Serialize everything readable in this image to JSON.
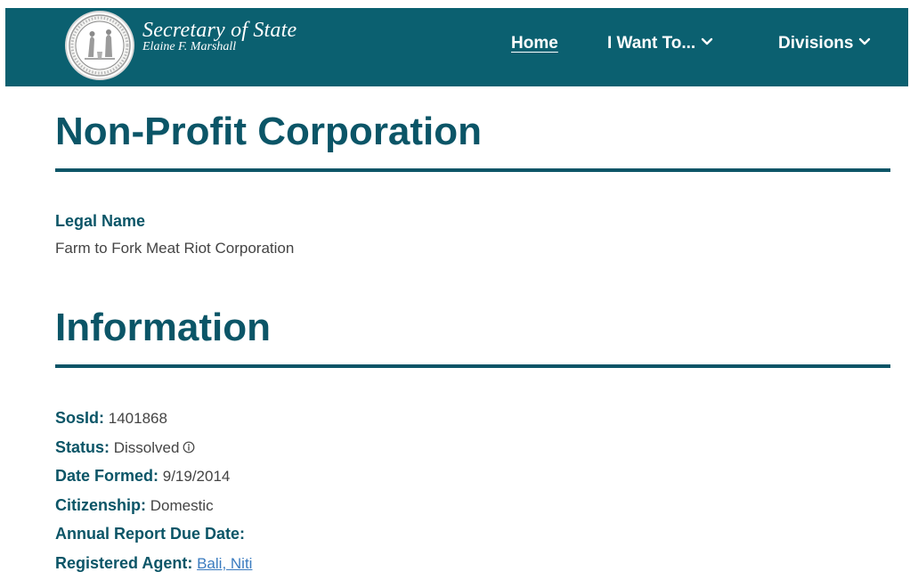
{
  "header": {
    "brand_title": "Secretary of State",
    "brand_subtitle": "Elaine F. Marshall",
    "nav": {
      "home_label": "Home",
      "want_label": "I Want To...",
      "divisions_label": "Divisions"
    }
  },
  "page": {
    "title": "Non-Profit Corporation",
    "legal_name_label": "Legal Name",
    "legal_name_value": "Farm to Fork Meat Riot Corporation",
    "info_heading": "Information",
    "info": {
      "sosid_label": "SosId:",
      "sosid_value": "1401868",
      "status_label": "Status:",
      "status_value": "Dissolved",
      "date_formed_label": "Date Formed:",
      "date_formed_value": "9/19/2014",
      "citizenship_label": "Citizenship:",
      "citizenship_value": "Domestic",
      "annual_report_label": "Annual Report Due Date:",
      "annual_report_value": "",
      "registered_agent_label": "Registered Agent:",
      "registered_agent_value": "Bali, Niti"
    }
  },
  "colors": {
    "header_bg": "#0b6070",
    "heading": "#0b5567",
    "link": "#3a7bbf",
    "body_text": "#444444"
  },
  "icons": {
    "seal": "state-seal-icon",
    "dropdown": "chevron-down-icon",
    "status_info": "info-circle-icon"
  }
}
